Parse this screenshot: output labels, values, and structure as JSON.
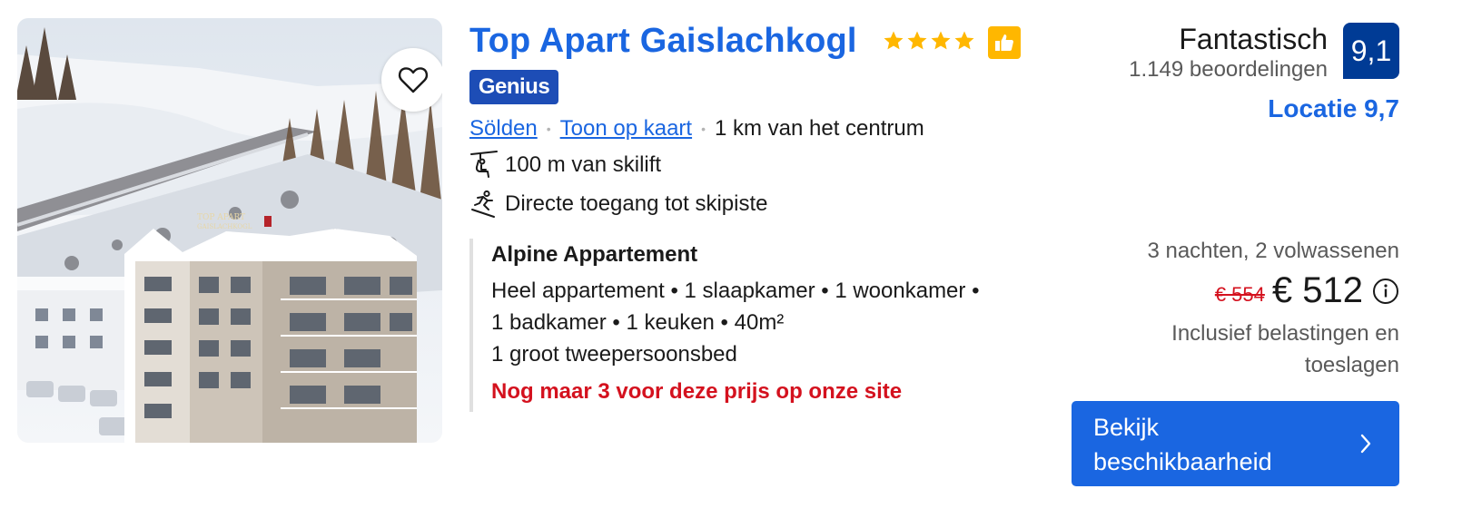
{
  "hotel": {
    "name": "Top Apart Gaislachkogl",
    "stars": 4,
    "genius_label": "Genius",
    "location_link": "Sölden",
    "map_link": "Toon op kaart",
    "distance": "1 km van het centrum",
    "features": [
      {
        "icon": "ski-lift-icon",
        "label": "100 m van skilift"
      },
      {
        "icon": "skier-icon",
        "label": "Directe toegang tot skipiste"
      }
    ],
    "photo_sign": "TOP APART GAISLACHKOGL"
  },
  "room": {
    "title": "Alpine Appartement",
    "line1": "Heel appartement • 1 slaapkamer • 1 woonkamer •",
    "line2": "1 badkamer • 1 keuken • 40m²",
    "line3": "1 groot tweepersoonsbed",
    "availability": "Nog maar 3 voor deze prijs op onze site"
  },
  "review": {
    "label": "Fantastisch",
    "count": "1.149 beoordelingen",
    "score": "9,1",
    "location_score": "Locatie 9,7"
  },
  "price": {
    "stay": "3 nachten, 2 volwassenen",
    "old": "€ 554",
    "new": "€ 512",
    "tax_note": "Inclusief belastingen en toeslagen"
  },
  "cta": {
    "label": "Bekijk beschikbaarheid"
  },
  "colors": {
    "link": "#1a66e1",
    "genius": "#1d4db6",
    "score_bg": "#003b95",
    "star": "#ffb700",
    "warning": "#d4111e",
    "cta_bg": "#1a66e1"
  }
}
